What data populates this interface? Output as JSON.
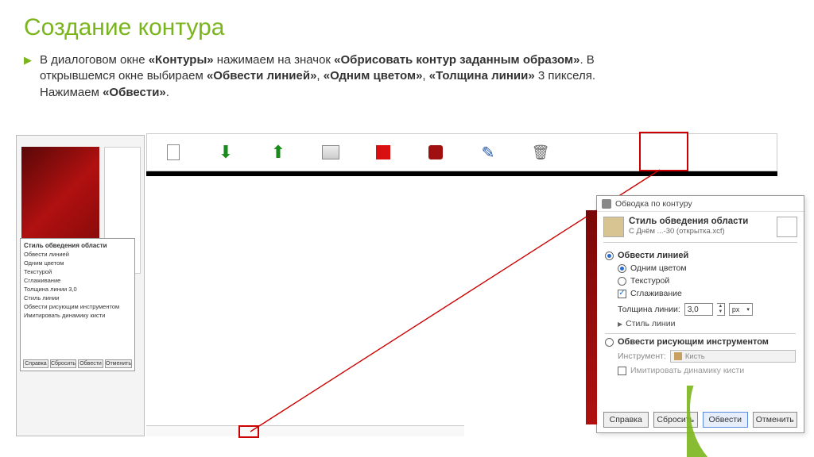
{
  "title": "Создание контура",
  "paragraph": {
    "p1": "В диалоговом окне ",
    "b1": "«Контуры»",
    "p2": " нажимаем на значок ",
    "b2": "«Обрисовать контур заданным образом»",
    "p3": ". В открывшемся окне выбираем ",
    "b3": "«Обвести линией»",
    "p4": ", ",
    "b4": "«Одним цветом»",
    "p5": ", ",
    "b5": "«Толщина линии»",
    "p6": " 3 пикселя. Нажимаем ",
    "b6": "«Обвести»",
    "p7": "."
  },
  "toolbar_icons": [
    "new",
    "green-down",
    "green-up",
    "book",
    "red-square",
    "red-blob",
    "brush-stroke",
    "trash"
  ],
  "mini_dialog": {
    "title": "Стиль обведения области",
    "lines": [
      "Обвести линией",
      "Одним цветом",
      "Текстурой",
      "Сглаживание",
      "Толщина линии  3,0",
      "Стиль линии",
      "Обвести рисующим инструментом",
      "Имитировать динамику кисти"
    ],
    "buttons": [
      "Справка",
      "Сбросить",
      "Обвести",
      "Отменить"
    ]
  },
  "dialog": {
    "window_title": "Обводка по контуру",
    "header_title": "Стиль обведения области",
    "header_sub": "С Днём ...-30 (открытка.xcf)",
    "opt_line": "Обвести линией",
    "opt_solid": "Одним цветом",
    "opt_texture": "Текстурой",
    "opt_antialias": "Сглаживание",
    "thickness_label": "Толщина линии:",
    "thickness_value": "3,0",
    "thickness_unit": "px",
    "style_expander": "Стиль линии",
    "opt_tool": "Обвести рисующим инструментом",
    "instrument_label": "Инструмент:",
    "instrument_value": "Кисть",
    "opt_dynamics": "Имитировать динамику кисти",
    "buttons": {
      "help": "Справка",
      "reset": "Сбросить",
      "ok": "Обвести",
      "cancel": "Отменить"
    }
  }
}
